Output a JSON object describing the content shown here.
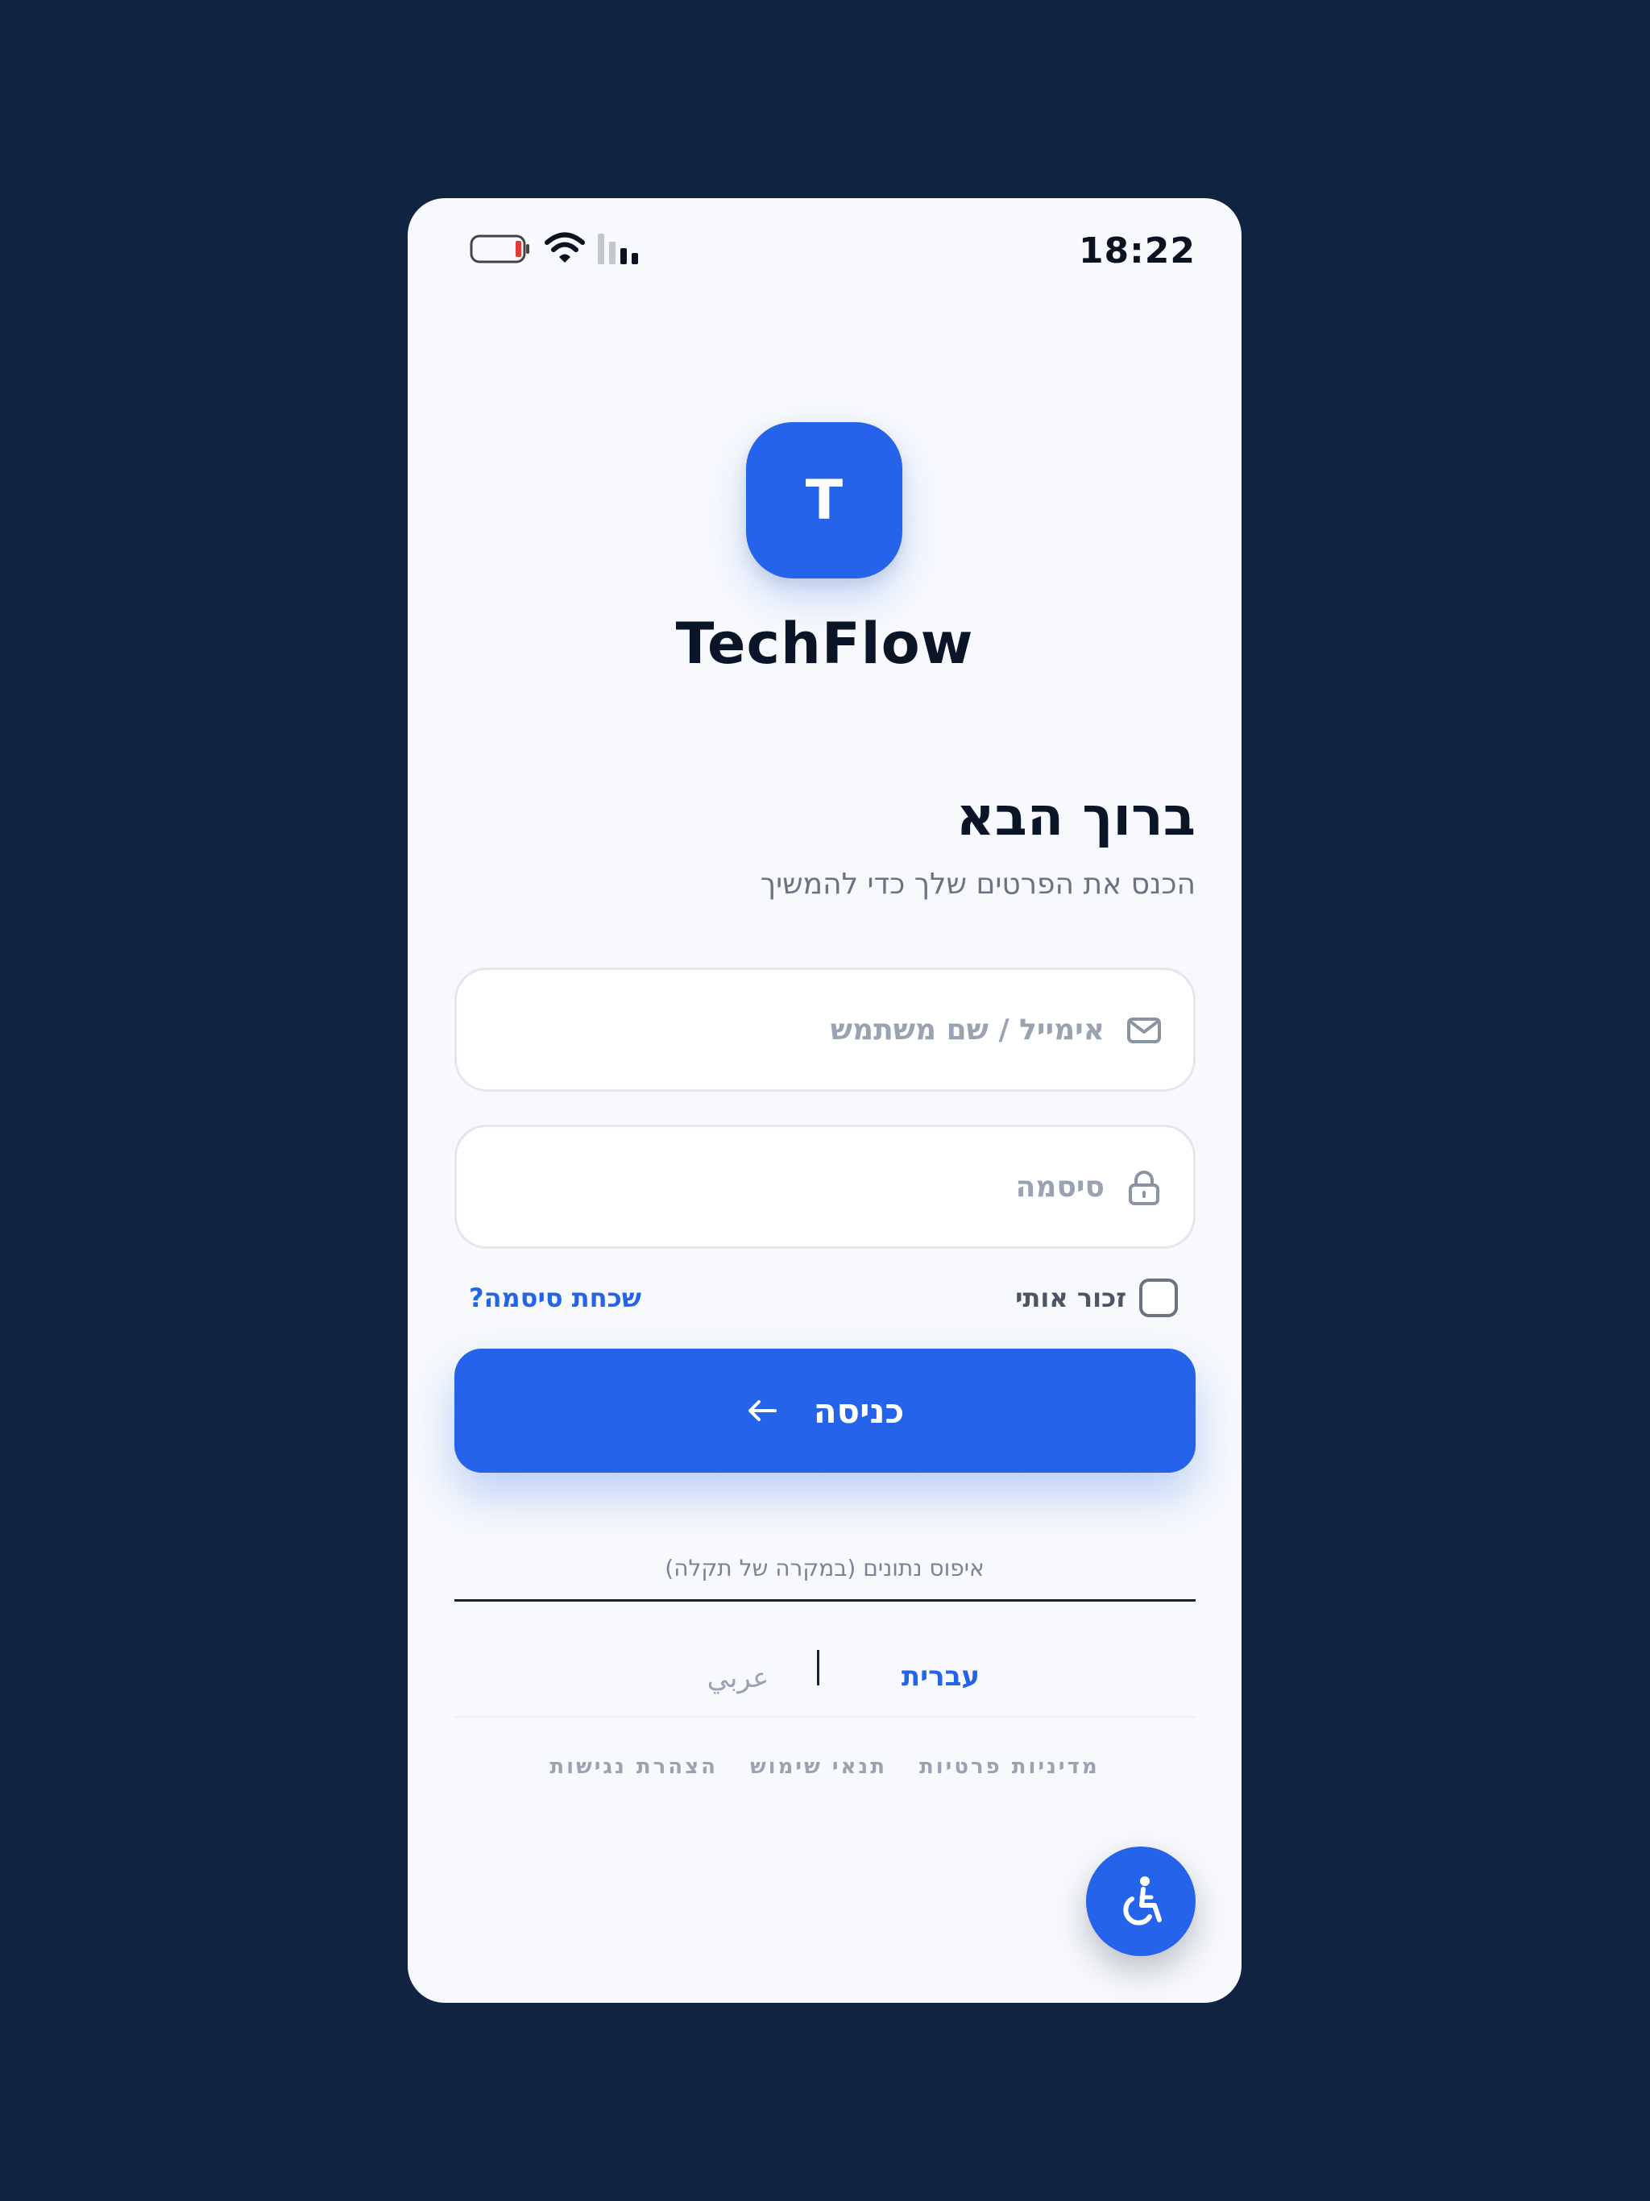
{
  "status_bar": {
    "time": "18:22"
  },
  "logo": {
    "letter": "T",
    "app_name": "TechFlow"
  },
  "welcome": {
    "title": "ברוך הבא",
    "subtitle": "הכנס את הפרטים שלך כדי להמשיך"
  },
  "form": {
    "email_placeholder": "אימייל / שם משתמש",
    "password_placeholder": "סיסמה",
    "remember_label": "זכור אותי",
    "forgot_label": "שכחת סיסמה?",
    "login_label": "כניסה",
    "reset_label": "איפוס נתונים (במקרה של תקלה)"
  },
  "languages": {
    "hebrew": "עברית",
    "arabic": "عربي"
  },
  "footer": {
    "privacy": "מדיניות פרטיות",
    "terms": "תנאי שימוש",
    "accessibility": "הצהרת נגישות"
  },
  "colors": {
    "background": "#10233f",
    "accent": "#2563eb",
    "card": "#f7f9fc"
  },
  "icons": {
    "email": "mail-icon",
    "password": "lock-icon",
    "login": "arrow-left-icon",
    "accessibility": "wheelchair-icon"
  }
}
